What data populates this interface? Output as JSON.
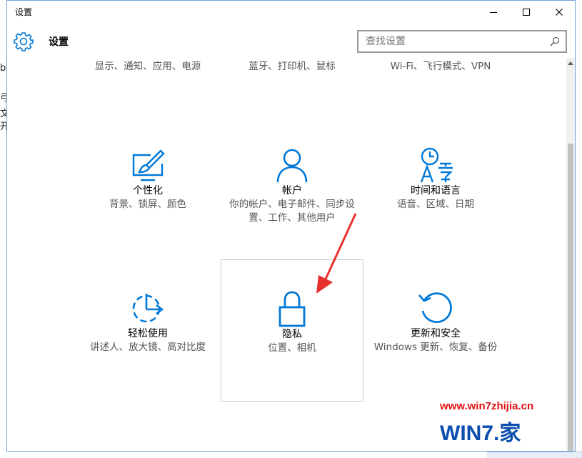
{
  "window": {
    "title": "设置",
    "controls": {
      "minimize": "minimize",
      "maximize": "maximize",
      "close": "close"
    }
  },
  "header": {
    "title": "设置",
    "search_placeholder": "查找设置"
  },
  "background_text": [
    "b",
    "弓",
    "文",
    "开"
  ],
  "top_row": [
    {
      "desc": "显示、通知、应用、电源"
    },
    {
      "desc": "蓝牙、打印机、鼠标"
    },
    {
      "desc": "Wi-Fi、飞行模式、VPN"
    }
  ],
  "tiles": [
    {
      "title": "个性化",
      "desc": "背景、锁屏、颜色",
      "icon": "personalization-icon"
    },
    {
      "title": "帐户",
      "desc": "你的帐户、电子邮件、同步设置、工作、其他用户",
      "icon": "account-icon"
    },
    {
      "title": "时间和语言",
      "desc": "语音、区域、日期",
      "icon": "time-language-icon"
    },
    {
      "title": "轻松使用",
      "desc": "讲述人、放大镜、高对比度",
      "icon": "ease-of-access-icon"
    },
    {
      "title": "隐私",
      "desc": "位置、相机",
      "icon": "lock-icon"
    },
    {
      "title": "更新和安全",
      "desc": "Windows 更新、恢复、备份",
      "icon": "update-icon"
    }
  ],
  "watermark": {
    "url": "www.win7zhijia.cn",
    "logo_text": "WIN7.家"
  },
  "colors": {
    "accent": "#0078d7",
    "arrow": "#e8312f",
    "text_secondary": "#555555"
  }
}
